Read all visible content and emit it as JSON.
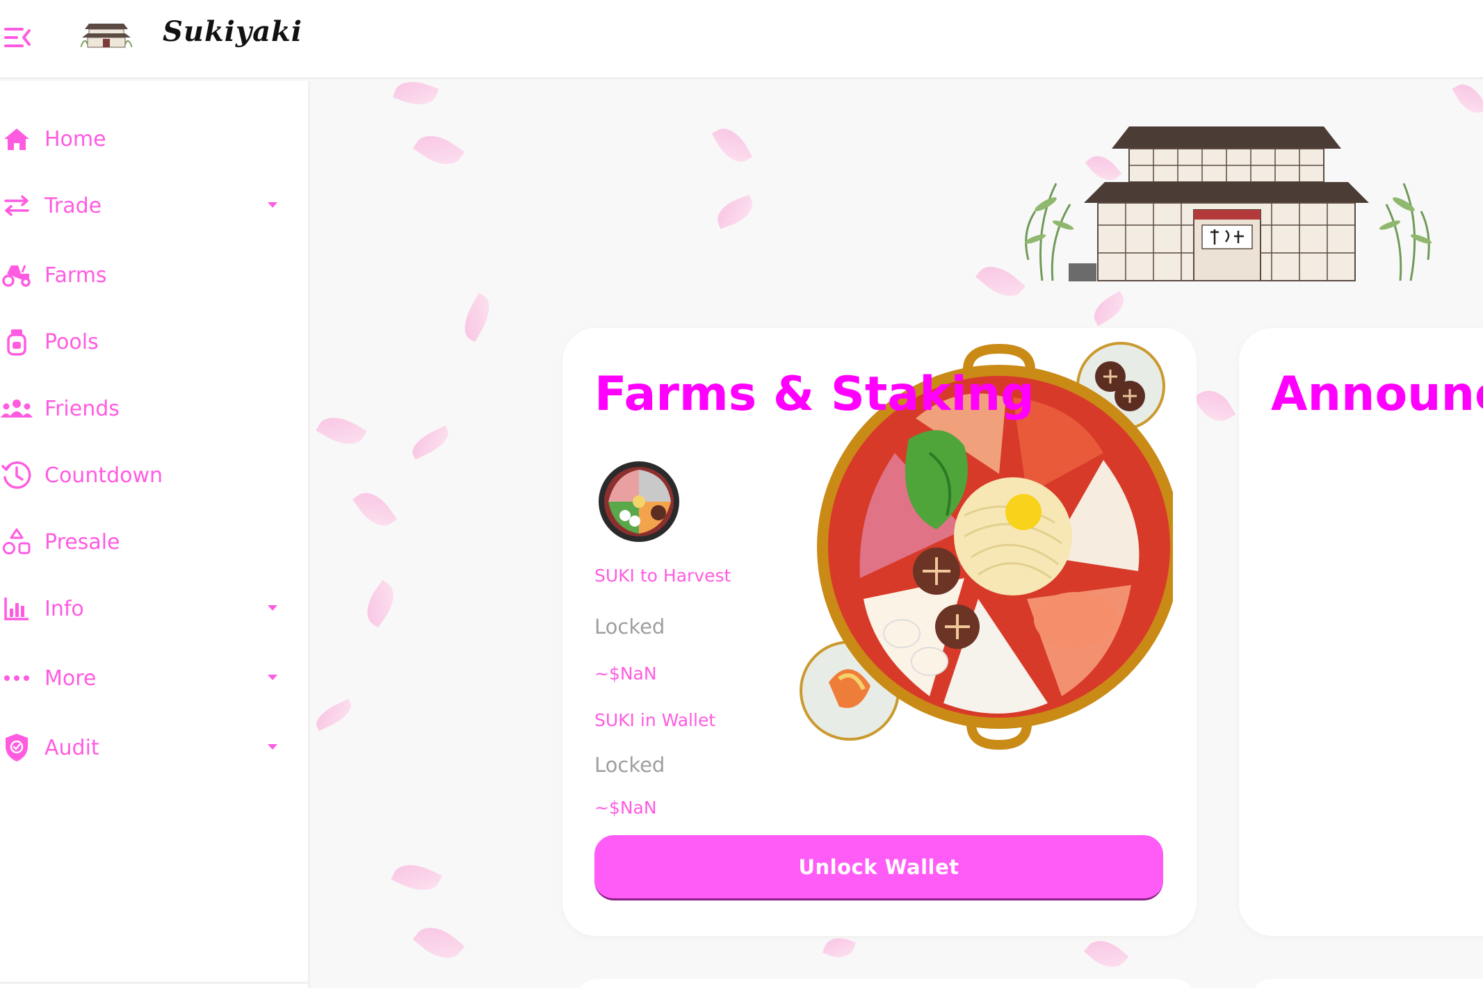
{
  "brand": {
    "name": "Sukiyaki"
  },
  "colors": {
    "accent": "#ff5be1",
    "title": "#ff00ff",
    "button": "#ff5bf7",
    "muted": "#9e9e9e"
  },
  "sidebar": {
    "items": [
      {
        "label": "Home",
        "icon": "home-icon",
        "has_dropdown": false
      },
      {
        "label": "Trade",
        "icon": "swap-arrows-icon",
        "has_dropdown": true
      },
      {
        "label": "Farms",
        "icon": "tractor-icon",
        "has_dropdown": false
      },
      {
        "label": "Pools",
        "icon": "pool-jar-icon",
        "has_dropdown": false
      },
      {
        "label": "Friends",
        "icon": "group-icon",
        "has_dropdown": false
      },
      {
        "label": "Countdown",
        "icon": "clock-history-icon",
        "has_dropdown": false
      },
      {
        "label": "Presale",
        "icon": "shapes-icon",
        "has_dropdown": false
      },
      {
        "label": "Info",
        "icon": "bar-chart-icon",
        "has_dropdown": true
      },
      {
        "label": "More",
        "icon": "more-dots-icon",
        "has_dropdown": true
      },
      {
        "label": "Audit",
        "icon": "shield-check-icon",
        "has_dropdown": true
      }
    ]
  },
  "farms_card": {
    "title": "Farms & Staking",
    "harvest_label": "SUKI to Harvest",
    "harvest_value": "Locked",
    "harvest_usd": "~$NaN",
    "wallet_label": "SUKI in Wallet",
    "wallet_value": "Locked",
    "wallet_usd": "~$NaN",
    "unlock_button": "Unlock Wallet"
  },
  "announce_card": {
    "title": "Announc"
  }
}
